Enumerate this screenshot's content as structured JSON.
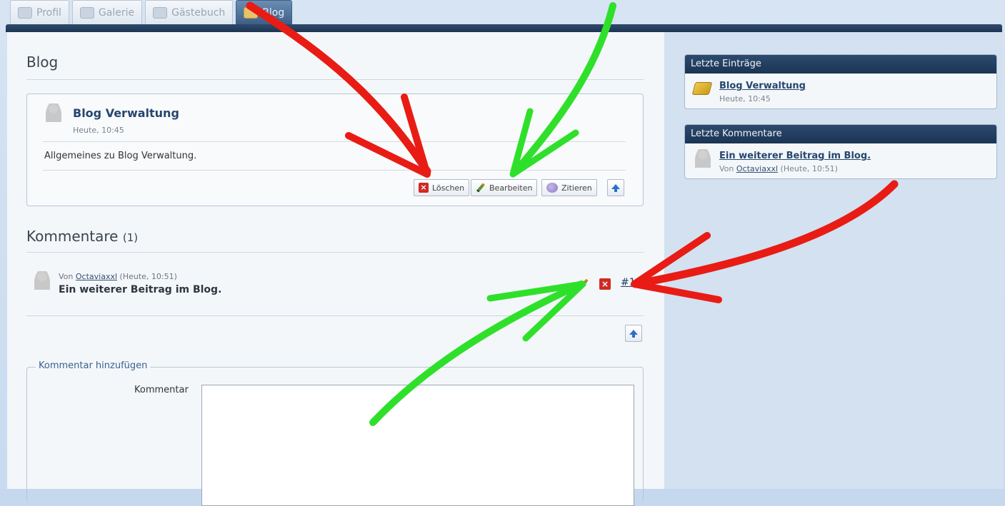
{
  "tabs": [
    {
      "label": "Profil",
      "icon": "profile-icon"
    },
    {
      "label": "Galerie",
      "icon": "gallery-icon"
    },
    {
      "label": "Gästebuch",
      "icon": "guestbook-icon"
    },
    {
      "label": "Blog",
      "icon": "blog-icon",
      "active": true
    }
  ],
  "main": {
    "title": "Blog",
    "entry": {
      "title": "Blog Verwaltung",
      "date": "Heute, 10:45",
      "text": "Allgemeines zu Blog Verwaltung.",
      "buttons": {
        "delete": "Löschen",
        "edit": "Bearbeiten",
        "quote": "Zitieren"
      }
    },
    "comments": {
      "title": "Kommentare",
      "count": "(1)",
      "items": [
        {
          "by": "Von",
          "author": "Octaviaxxl",
          "time": "(Heute, 10:51)",
          "text": "Ein weiterer Beitrag im Blog.",
          "number": "#1"
        }
      ]
    },
    "add_comment": {
      "legend": "Kommentar hinzufügen",
      "label": "Kommentar",
      "value": ""
    }
  },
  "sidebar": {
    "recent_entries": {
      "title": "Letzte Einträge",
      "items": [
        {
          "title": "Blog Verwaltung",
          "date": "Heute, 10:45"
        }
      ]
    },
    "recent_comments": {
      "title": "Letzte Kommentare",
      "items": [
        {
          "title": "Ein weiterer Beitrag im Blog.",
          "by": "Von",
          "author": "Octaviaxxl",
          "time": "(Heute, 10:51)"
        }
      ]
    }
  },
  "colors": {
    "arrow_red": "#e81c14",
    "arrow_green": "#2fe02a",
    "header_dark": "#1d3553",
    "link": "#26476d"
  }
}
